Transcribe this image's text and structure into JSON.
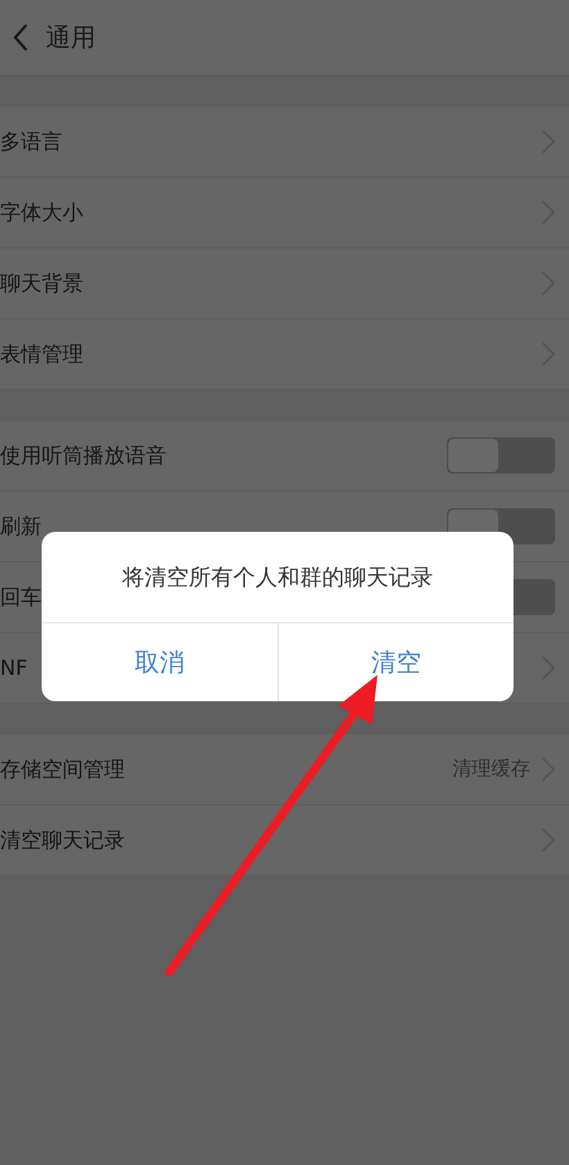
{
  "header": {
    "title": "通用"
  },
  "sections": [
    {
      "rows": [
        {
          "kind": "link",
          "label": "多语言"
        },
        {
          "kind": "link",
          "label": "字体大小"
        },
        {
          "kind": "link",
          "label": "聊天背景"
        },
        {
          "kind": "link",
          "label": "表情管理"
        }
      ]
    },
    {
      "rows": [
        {
          "kind": "toggle",
          "label": "使用听筒播放语音",
          "on": false
        },
        {
          "kind": "toggle",
          "label": "刷新",
          "on": false
        },
        {
          "kind": "toggle",
          "label": "回车",
          "on": false
        },
        {
          "kind": "link",
          "label": "NF"
        }
      ]
    },
    {
      "rows": [
        {
          "kind": "link",
          "label": "存储空间管理",
          "value": "清理缓存"
        },
        {
          "kind": "link",
          "label": "清空聊天记录"
        }
      ]
    }
  ],
  "dialog": {
    "message": "将清空所有个人和群的聊天记录",
    "buttons": [
      "取消",
      "清空"
    ]
  }
}
